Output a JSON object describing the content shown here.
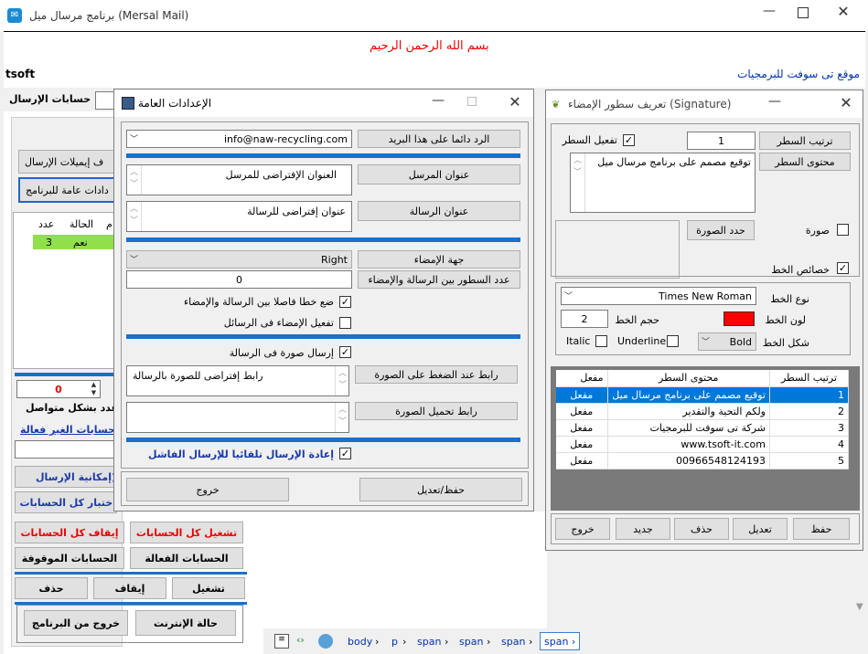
{
  "main": {
    "title": "برنامج مرسال ميل (Mersal Mail)",
    "bismillah": "بسم الله الرحمن الرحيم",
    "tsoft": "tsoft",
    "site_link": "موقع تى سوفت للبرمجيات",
    "accounts_label": "حسابات الإرسال",
    "btn_templates": "ف إيميلات الإرسال",
    "btn_settings": "دادات عامة للبرنامج",
    "table_headers": [
      "عدد",
      "الحالة",
      "م"
    ],
    "table_row": [
      "3",
      "نعم"
    ],
    "counter_value": "0",
    "counter_label": "عدد بشكل متواصل",
    "inactive_label": "الحسابات الغير فعالة",
    "btn_capability": "إمكانية الإرسال)",
    "btn_test_all": "اختبار كل الحسابات",
    "btn_start_all": "تشغيل كل الحسابات",
    "btn_stop_all": "إيقاف كل الحسابات",
    "btn_active": "الحسابات الفعالة",
    "btn_stopped": "الحسابات الموقوفة",
    "btn_run": "تشغيل",
    "btn_pause": "إيقاف",
    "btn_delete": "حذف",
    "btn_exit_program": "خروج من البرنامج",
    "btn_internet": "حالة الإنترنت",
    "status_path": [
      "body",
      "p",
      "span",
      "span",
      "span",
      "span"
    ]
  },
  "settings": {
    "title": "الإعدادات العامة",
    "reply_value": "info@naw-recycling.com",
    "reply_label": "الرد دائما على هذا البريد",
    "sender_value": "العنوان الإفتراضى للمرسل",
    "sender_label": "عنوان المرسل",
    "subject_value": "عنوان إفتراضى للرسالة",
    "subject_label": "عنوان الرسالة",
    "sig_side_value": "Right",
    "sig_side_label": "جهة الإمضاء",
    "lines_value": "0",
    "lines_label": "عدد السطور بين الرسالة والإمضاء",
    "chk_separator": "ضع خطا فاصلا بين الرسالة والإمضاء",
    "chk_enable_sig": "تفعيل الإمضاء فى الرسائل",
    "chk_image": "إرسال صورة فى الرسالة",
    "click_link_value": "رابط إفتراضى للصورة بالرسالة",
    "click_link_label": "رابط عند الضغط على الصورة",
    "load_link_label": "رابط تحميل الصورة",
    "chk_resend": "إعادة الإرسال تلقائيا للإرسال الفاشل",
    "btn_exit": "خروج",
    "btn_save": "حفظ/تعديل"
  },
  "signature": {
    "title": "تعريف سطور الإمضاء (Signature)",
    "order_label": "ترتيب السطر",
    "order_value": "1",
    "enable_label": "تفعيل السطر",
    "content_label": "محتوى السطر",
    "content_value": "توقيع مصمم على برنامج مرسال ميل",
    "image_label": "صورة",
    "pick_image": "حدد الصورة",
    "font_props": "خصائص الخط",
    "font_type_label": "نوع الخط",
    "font_type_value": "Times New Roman",
    "font_color_label": "لون الخط",
    "font_size_label": "حجم الخط",
    "font_size_value": "2",
    "font_shape_label": "شكل الخط",
    "font_shape_value": "Bold",
    "italic": "Italic",
    "underline": "Underline",
    "table_headers": [
      "ترتيب السطر",
      "محتوى السطر",
      "مفعل"
    ],
    "rows": [
      [
        "1",
        "توقيع مصمم على برنامج مرسال ميل",
        "مفعل"
      ],
      [
        "2",
        "ولكم التحية والتقدير",
        "مفعل"
      ],
      [
        "3",
        "شركة تى سوفت للبرمجيات",
        "مفعل"
      ],
      [
        "4",
        "www.tsoft-it.com",
        "مفعل"
      ],
      [
        "5",
        "00966548124193",
        "مفعل"
      ]
    ],
    "btn_save": "حفظ",
    "btn_edit": "تعديل",
    "btn_delete": "حذف",
    "btn_new": "جديد",
    "btn_exit": "خروج"
  }
}
